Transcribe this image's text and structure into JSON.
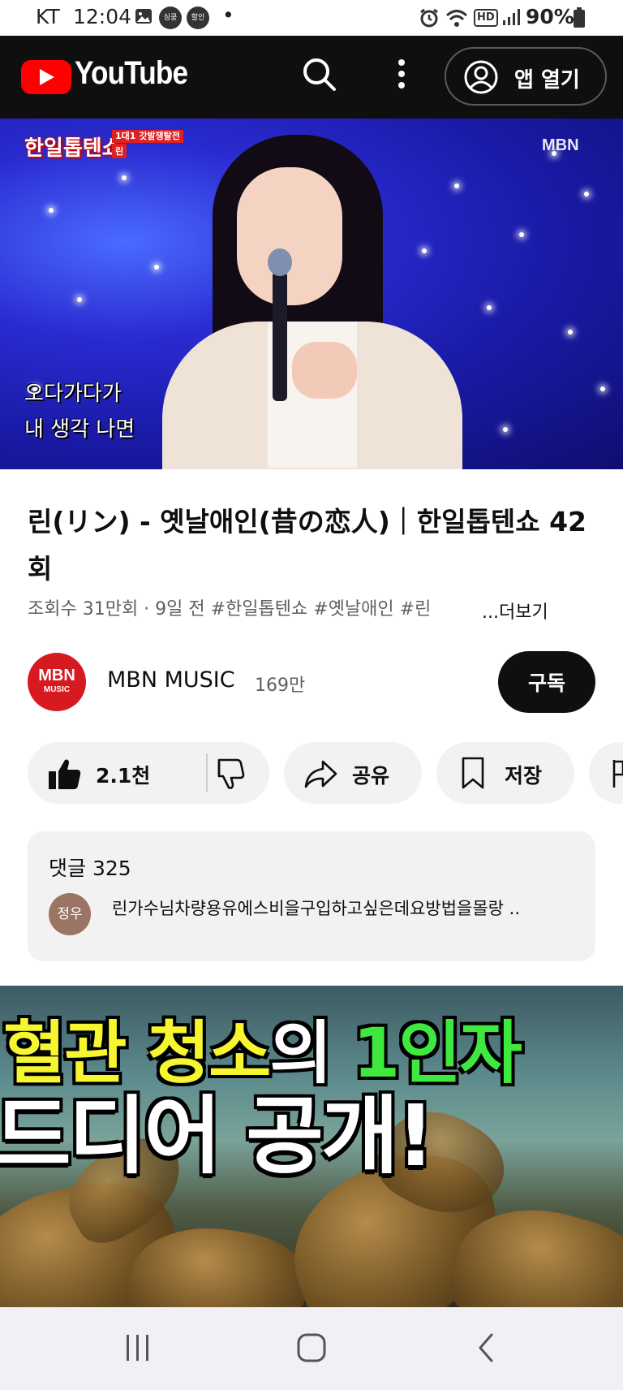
{
  "status_bar": {
    "carrier": "KT",
    "time": "12:04",
    "notif_badge_1": "심쿵",
    "notif_badge_2": "할인",
    "dot": "•",
    "hd_badge": "HD",
    "battery": "90%"
  },
  "header": {
    "brand": "YouTube",
    "open_app_label": "앱 열기"
  },
  "video": {
    "show_logo": "한일톱텐쇼",
    "show_tag": "1대1 갓발쟁탈전",
    "show_tag_name": "린",
    "network_mark": "MBN",
    "lyric_line_1": "오다가다가",
    "lyric_line_2": "내 생각 나면"
  },
  "details": {
    "title": "린(リン) - 옛날애인(昔の恋人)｜한일톱텐쇼 42회",
    "meta": "조회수 31만회 · 9일 전  #한일톱텐쇼 #옛날애인 #린",
    "more_label": "...더보기"
  },
  "channel": {
    "avatar_top": "MBN",
    "avatar_bottom": "MUSIC",
    "name": "MBN MUSIC",
    "subscribers": "169만",
    "subscribe_label": "구독"
  },
  "actions": {
    "like_count": "2.1천",
    "share_label": "공유",
    "save_label": "저장"
  },
  "comments": {
    "header_label": "댓글",
    "count": "325",
    "top_author_avatar": "정우",
    "top_comment": "린가수님차량용유에스비을구입하고싶은데요방법을몰랑 .."
  },
  "ad": {
    "line1_part1": "혈관 청소",
    "line1_part2": "의 ",
    "line1_part3": "1인자",
    "line2": "드디어 공개!"
  },
  "colors": {
    "youtube_red": "#ff0000",
    "header_bg": "#0f0f0f",
    "pill_bg": "#f2f2f2",
    "mbn_red": "#d71920"
  },
  "icons": [
    "search-icon",
    "more-vert-icon",
    "account-icon",
    "thumbs-up-icon",
    "thumbs-down-icon",
    "share-icon",
    "bookmark-icon",
    "recents-icon",
    "home-icon",
    "back-icon"
  ]
}
